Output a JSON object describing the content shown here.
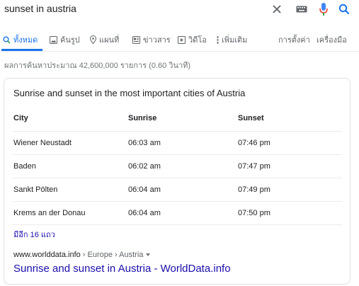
{
  "search": {
    "query": "sunset in austria"
  },
  "icons": {
    "close": "close-icon",
    "keyboard": "keyboard-icon",
    "mic": "microphone-icon",
    "search": "search-icon"
  },
  "tabs": [
    {
      "label": "ทั้งหมด",
      "icon": "search-icon",
      "active": true
    },
    {
      "label": "ค้นรูป",
      "icon": "image-icon"
    },
    {
      "label": "แผนที่",
      "icon": "map-pin-icon"
    },
    {
      "label": "ข่าวสาร",
      "icon": "news-icon"
    },
    {
      "label": "วิดีโอ",
      "icon": "video-icon"
    },
    {
      "label": "เพิ่มเติม",
      "icon": "more-vert-icon"
    }
  ],
  "tools": {
    "settings": "การตั้งค่า",
    "tools": "เครื่องมือ"
  },
  "stats": "ผลการค้นหาประมาณ 42,600,000 รายการ (0.60 วินาที)",
  "card": {
    "title": "Sunrise and sunset in the most important cities of Austria",
    "headers": [
      "City",
      "Sunrise",
      "Sunset"
    ],
    "rows": [
      [
        "Wiener Neustadt",
        "06:03 am",
        "07:46 pm"
      ],
      [
        "Baden",
        "06:02 am",
        "07:47 pm"
      ],
      [
        "Sankt Pölten",
        "06:04 am",
        "07:49 pm"
      ],
      [
        "Krems an der Donau",
        "06:04 am",
        "07:50 pm"
      ]
    ],
    "more": "มีอีก 16 แถว",
    "source_domain": "www.worlddata.info",
    "source_path": "› Europe › Austria",
    "link": "Sunrise and sunset in Austria - WorldData.info"
  },
  "colors": {
    "accent": "#1a73e8",
    "link": "#1a0dab",
    "mic_red": "#ea4335"
  }
}
